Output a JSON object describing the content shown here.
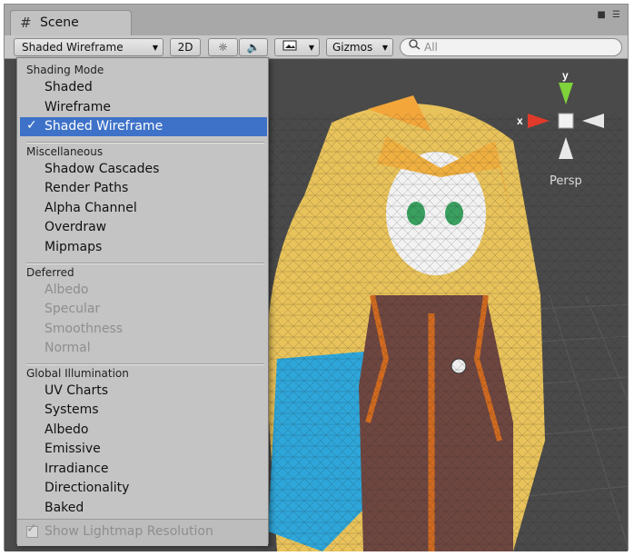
{
  "window": {
    "tab_label": "Scene",
    "hash_icon": "#"
  },
  "toolbar": {
    "draw_mode": "Shaded Wireframe",
    "twod": "2D",
    "gizmos": "Gizmos",
    "search_placeholder": "All"
  },
  "scene": {
    "projection": "Persp",
    "axis_x": "x",
    "axis_y": "y"
  },
  "menu": {
    "sections": [
      {
        "header": "Shading Mode",
        "items": [
          "Shaded",
          "Wireframe",
          "Shaded Wireframe"
        ]
      },
      {
        "header": "Miscellaneous",
        "items": [
          "Shadow Cascades",
          "Render Paths",
          "Alpha Channel",
          "Overdraw",
          "Mipmaps"
        ]
      },
      {
        "header": "Deferred",
        "items": [
          "Albedo",
          "Specular",
          "Smoothness",
          "Normal"
        ]
      },
      {
        "header": "Global Illumination",
        "items": [
          "UV Charts",
          "Systems",
          "Albedo",
          "Emissive",
          "Irradiance",
          "Directionality",
          "Baked"
        ]
      }
    ],
    "checkmark": "✓",
    "footer_option": "Show Lightmap Resolution"
  },
  "colors": {
    "selection": "#3e72c8",
    "viewport": "#4a4a4a"
  }
}
